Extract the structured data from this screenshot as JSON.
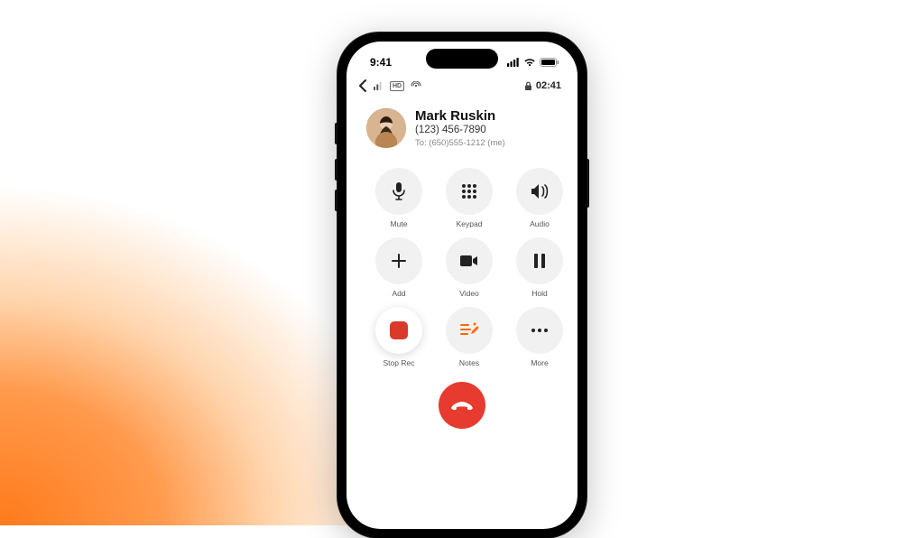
{
  "status_bar": {
    "time": "9:41"
  },
  "nav": {
    "hd_badge": "HD",
    "duration": "02:41"
  },
  "caller": {
    "name": "Mark Ruskin",
    "phone": "(123) 456-7890",
    "to_line": "To: (650)555-1212 (me)"
  },
  "actions": {
    "mute": {
      "label": "Mute"
    },
    "keypad": {
      "label": "Keypad"
    },
    "audio": {
      "label": "Audio"
    },
    "add": {
      "label": "Add"
    },
    "video": {
      "label": "Video"
    },
    "hold": {
      "label": "Hold"
    },
    "stop_rec": {
      "label": "Stop Rec"
    },
    "notes": {
      "label": "Notes"
    },
    "more": {
      "label": "More"
    }
  },
  "colors": {
    "accent_orange": "#ff6a00",
    "end_call_red": "#e63b2e",
    "record_red": "#d93a2b"
  }
}
